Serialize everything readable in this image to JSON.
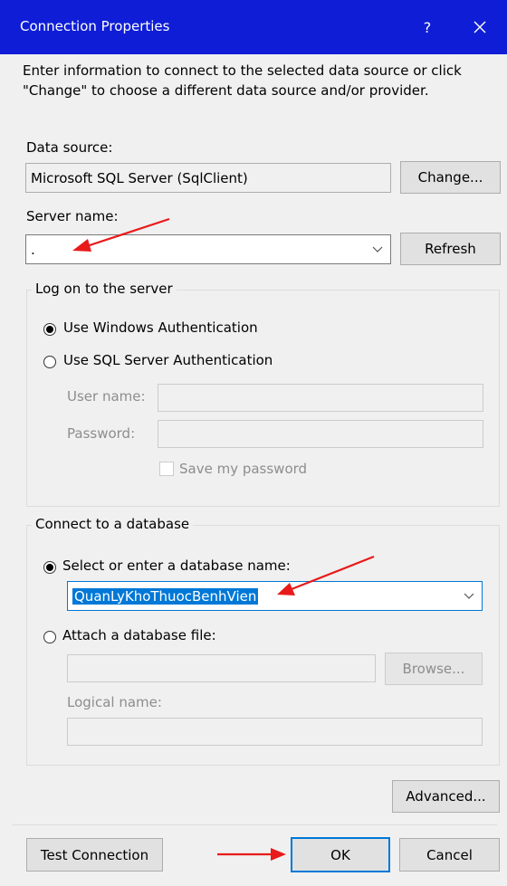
{
  "window": {
    "title": "Connection Properties",
    "help_label": "?",
    "colors": {
      "titlebar": "#0f1ed6",
      "accent": "#0078d7",
      "annotation_arrow": "#e81a1a"
    }
  },
  "intro_text": "Enter information to connect to the selected data source or click \"Change\" to choose a different data source and/or provider.",
  "data_source": {
    "label": "Data source:",
    "value": "Microsoft SQL Server (SqlClient)",
    "change_button": "Change..."
  },
  "server": {
    "label": "Server name:",
    "value": ".",
    "refresh_button": "Refresh"
  },
  "logon": {
    "group_label": "Log on to the server",
    "windows_auth": "Use Windows Authentication",
    "sql_auth": "Use SQL Server Authentication",
    "selected": "windows",
    "username_label": "User name:",
    "password_label": "Password:",
    "save_password": "Save my password"
  },
  "database": {
    "group_label": "Connect to a database",
    "select_option": "Select or enter a database name:",
    "database_name": "QuanLyKhoThuocBenhVien",
    "attach_option": "Attach a database file:",
    "browse_button": "Browse...",
    "logical_name_label": "Logical name:",
    "selected": "select"
  },
  "buttons": {
    "advanced": "Advanced...",
    "test_connection": "Test Connection",
    "ok": "OK",
    "cancel": "Cancel"
  }
}
